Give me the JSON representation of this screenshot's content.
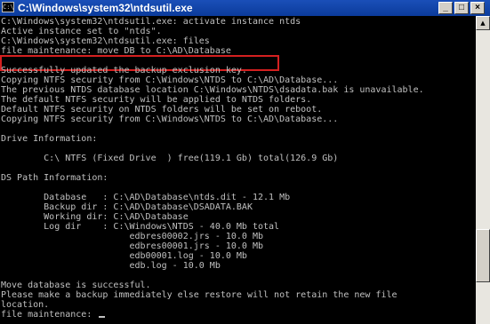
{
  "window": {
    "title": "C:\\Windows\\system32\\ntdsutil.exe",
    "icon_label": "C:\\",
    "buttons": {
      "minimize": "_",
      "maximize": "□",
      "close": "×"
    }
  },
  "console": {
    "lines": [
      "C:\\Windows\\system32\\ntdsutil.exe: activate instance ntds",
      "Active instance set to \"ntds\".",
      "C:\\Windows\\system32\\ntdsutil.exe: files",
      "file maintenance: move DB to C:\\AD\\Database",
      "",
      "Successfully updated the backup exclusion key.",
      "Copying NTFS security from C:\\Windows\\NTDS to C:\\AD\\Database...",
      "The previous NTDS database location C:\\Windows\\NTDS\\dsadata.bak is unavailable.",
      "The default NTFS security will be applied to NTDS folders.",
      "Default NTFS security on NTDS folders will be set on reboot.",
      "Copying NTFS security from C:\\Windows\\NTDS to C:\\AD\\Database...",
      "",
      "Drive Information:",
      "",
      "        C:\\ NTFS (Fixed Drive  ) free(119.1 Gb) total(126.9 Gb)",
      "",
      "DS Path Information:",
      "",
      "        Database   : C:\\AD\\Database\\ntds.dit - 12.1 Mb",
      "        Backup dir : C:\\AD\\Database\\DSADATA.BAK",
      "        Working dir: C:\\AD\\Database",
      "        Log dir    : C:\\Windows\\NTDS - 40.0 Mb total",
      "                        edbres00002.jrs - 10.0 Mb",
      "                        edbres00001.jrs - 10.0 Mb",
      "                        edb00001.log - 10.0 Mb",
      "                        edb.log - 10.0 Mb",
      "",
      "Move database is successful.",
      "Please make a backup immediately else restore will not retain the new file",
      "location.",
      "file maintenance: "
    ]
  },
  "highlight_color": "#d42020",
  "scrollbar": {
    "up_arrow": "▲"
  }
}
